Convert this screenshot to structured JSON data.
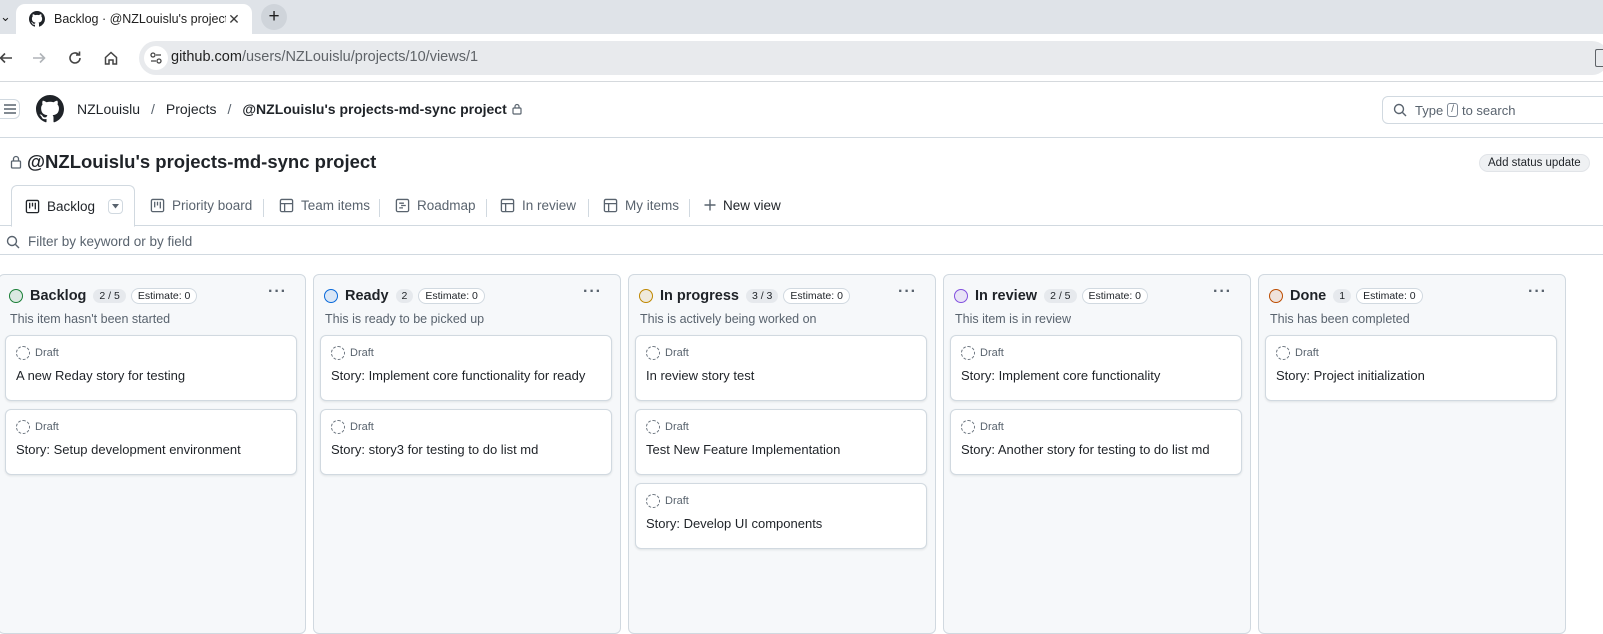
{
  "browser": {
    "tab_title": "Backlog · @NZLouislu's projects",
    "tab_close": "✕",
    "new_tab": "+",
    "url_host": "github.com",
    "url_path": "/users/NZLouislu/projects/10/views/1"
  },
  "header": {
    "breadcrumbs": [
      "NZLouislu",
      "Projects"
    ],
    "separator": "/",
    "current": "@NZLouislu's projects-md-sync project",
    "search_prefix": "Type",
    "search_key": "/",
    "search_suffix": "to search"
  },
  "project": {
    "title": "@NZLouislu's projects-md-sync project",
    "status_button": "Add status update"
  },
  "views": [
    {
      "label": "Backlog",
      "icon": "board-icon",
      "active": true
    },
    {
      "label": "Priority board",
      "icon": "board-icon"
    },
    {
      "label": "Team items",
      "icon": "table-icon"
    },
    {
      "label": "Roadmap",
      "icon": "roadmap-icon"
    },
    {
      "label": "In review",
      "icon": "table-icon"
    },
    {
      "label": "My items",
      "icon": "table-icon"
    },
    {
      "label": "New view",
      "icon": "plus-icon"
    }
  ],
  "filter": {
    "placeholder": "Filter by keyword or by field"
  },
  "columns": [
    {
      "name": "Backlog",
      "count": "2 / 5",
      "estimate": "Estimate: 0",
      "color": "#1a7f37",
      "description": "This item hasn't been started",
      "cards": [
        {
          "meta": "Draft",
          "title": "A new Reday story for testing"
        },
        {
          "meta": "Draft",
          "title": "Story: Setup development environment"
        }
      ]
    },
    {
      "name": "Ready",
      "count": "2",
      "estimate": "Estimate: 0",
      "color": "#0969da",
      "description": "This is ready to be picked up",
      "cards": [
        {
          "meta": "Draft",
          "title": "Story: Implement core functionality for ready"
        },
        {
          "meta": "Draft",
          "title": "Story: story3 for testing to do list md"
        }
      ]
    },
    {
      "name": "In progress",
      "count": "3 / 3",
      "estimate": "Estimate: 0",
      "color": "#bf8700",
      "description": "This is actively being worked on",
      "cards": [
        {
          "meta": "Draft",
          "title": "In review story test"
        },
        {
          "meta": "Draft",
          "title": "Test New Feature Implementation"
        },
        {
          "meta": "Draft",
          "title": "Story: Develop UI components"
        }
      ]
    },
    {
      "name": "In review",
      "count": "2 / 5",
      "estimate": "Estimate: 0",
      "color": "#8250df",
      "description": "This item is in review",
      "cards": [
        {
          "meta": "Draft",
          "title": "Story: Implement core functionality"
        },
        {
          "meta": "Draft",
          "title": "Story: Another story for testing to do list md"
        }
      ]
    },
    {
      "name": "Done",
      "count": "1",
      "estimate": "Estimate: 0",
      "color": "#bc4c00",
      "description": "This has been completed",
      "cards": [
        {
          "meta": "Draft",
          "title": "Story: Project initialization"
        }
      ]
    }
  ]
}
